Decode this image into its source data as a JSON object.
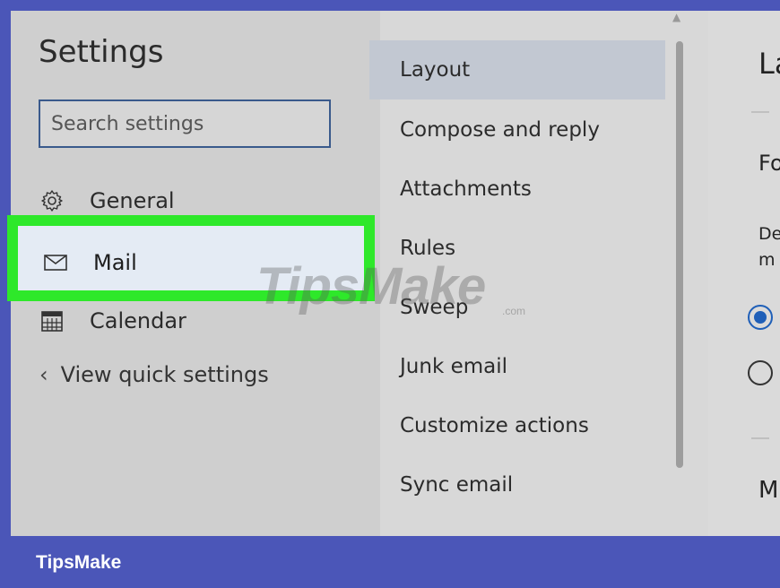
{
  "settings": {
    "title": "Settings",
    "search_placeholder": "Search settings"
  },
  "left_nav": {
    "items": [
      {
        "label": "General",
        "icon": "gear-icon"
      },
      {
        "label": "Mail",
        "icon": "envelope-icon"
      },
      {
        "label": "Calendar",
        "icon": "calendar-icon"
      }
    ],
    "selected": "Mail",
    "highlight_color": "#2ee82a",
    "quick_settings": "View quick settings"
  },
  "mail_nav": {
    "items": [
      {
        "label": "Layout"
      },
      {
        "label": "Compose and reply"
      },
      {
        "label": "Attachments"
      },
      {
        "label": "Rules"
      },
      {
        "label": "Sweep"
      },
      {
        "label": "Junk email"
      },
      {
        "label": "Customize actions"
      },
      {
        "label": "Sync email"
      }
    ],
    "selected": "Layout"
  },
  "right_panel": {
    "heading_fragment": "La",
    "section_fragment": "Fo",
    "desc_line1": "De",
    "desc_line2": "m",
    "section2_fragment": "M"
  },
  "watermark": {
    "text": "TipsMake",
    "sub": ".com"
  },
  "footer": {
    "brand": "TipsMake"
  },
  "colors": {
    "frame": "#4b56b8",
    "accent_highlight": "#2ee82a",
    "selected_item_bg": "#c2c8d2",
    "radio_selected": "#1f5fb8"
  }
}
